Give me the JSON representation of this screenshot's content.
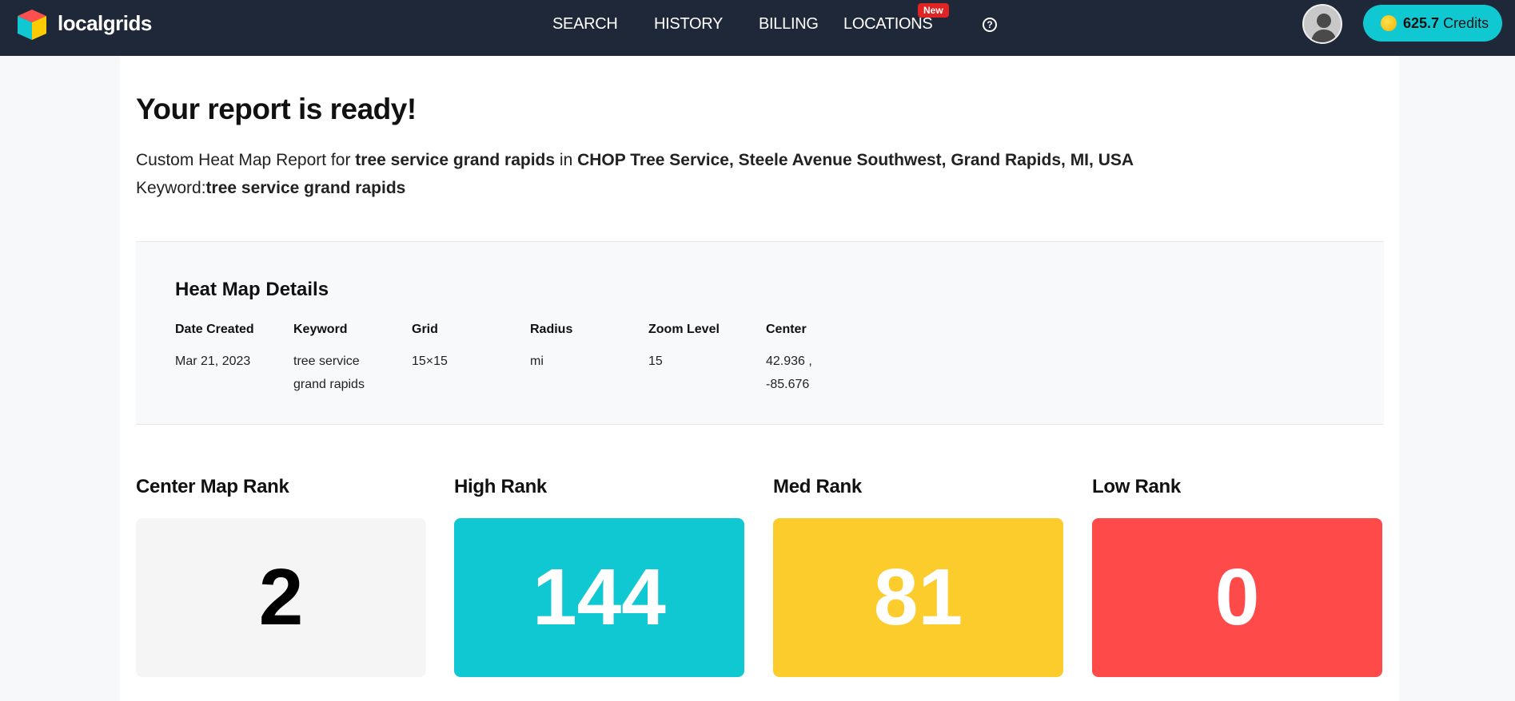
{
  "header": {
    "brand": "localgrids",
    "nav": [
      "SEARCH",
      "HISTORY",
      "BILLING",
      "LOCATIONS"
    ],
    "new_badge": "New",
    "help": "?",
    "credits_amount": "625.7",
    "credits_label": "Credits"
  },
  "report": {
    "title": "Your report is ready!",
    "intro_prefix": "Custom Heat Map Report for ",
    "intro_keyword": "tree service grand rapids",
    "intro_in": " in ",
    "intro_location": "CHOP Tree Service, Steele Avenue Southwest, Grand Rapids, MI, USA",
    "keyword_label": "Keyword:",
    "keyword_value": "tree service grand rapids"
  },
  "details": {
    "title": "Heat Map Details",
    "columns": [
      {
        "h": "Date Created",
        "v": "Mar 21, 2023"
      },
      {
        "h": "Keyword",
        "v": "tree service grand rapids"
      },
      {
        "h": "Grid",
        "v": "15×15"
      },
      {
        "h": "Radius",
        "v": "mi"
      },
      {
        "h": "Zoom Level",
        "v": "15"
      },
      {
        "h": "Center",
        "v": "42.936 , -85.676"
      }
    ]
  },
  "ranks": [
    {
      "label": "Center Map Rank",
      "value": "2",
      "color": "#f5f5f5"
    },
    {
      "label": "High Rank",
      "value": "144",
      "color": "#0fc8d2"
    },
    {
      "label": "Med Rank",
      "value": "81",
      "color": "#fccb2c"
    },
    {
      "label": "Low Rank",
      "value": "0",
      "color": "#ff4a4a"
    }
  ]
}
